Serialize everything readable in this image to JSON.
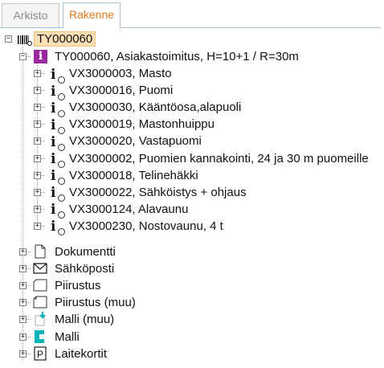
{
  "tabs": [
    {
      "label": "Arkisto",
      "active": false
    },
    {
      "label": "Rakenne",
      "active": true
    }
  ],
  "tree": {
    "root": {
      "label": "TY000060",
      "icon": "barcode-icon"
    },
    "object": {
      "label": "TY000060, Asiakastoimitus, H=10+1 / R=30m",
      "icon": "purple-info-icon"
    },
    "components": [
      {
        "label": "VX3000003, Masto"
      },
      {
        "label": "VX3000016, Puomi"
      },
      {
        "label": "VX3000030, Kääntöosa,alapuoli"
      },
      {
        "label": "VX3000019, Mastonhuippu"
      },
      {
        "label": "VX3000020, Vastapuomi"
      },
      {
        "label": "VX3000002, Puomien kannakointi, 24 ja 30 m puomeille"
      },
      {
        "label": "VX3000018, Telinehäkki"
      },
      {
        "label": "VX3000022, Sähköistys + ohjaus"
      },
      {
        "label": "VX3000124, Alavaunu"
      },
      {
        "label": "VX3000230, Nostovaunu, 4 t"
      }
    ],
    "folders": [
      {
        "label": "Dokumentti",
        "icon": "document-icon"
      },
      {
        "label": "Sähköposti",
        "icon": "envelope-icon"
      },
      {
        "label": "Piirustus",
        "icon": "drawing-icon"
      },
      {
        "label": "Piirustus (muu)",
        "icon": "drawing-other-icon"
      },
      {
        "label": "Malli (muu)",
        "icon": "model-other-icon"
      },
      {
        "label": "Malli",
        "icon": "model-icon"
      },
      {
        "label": "Laitekortit",
        "icon": "device-card-icon"
      }
    ],
    "colors": {
      "accent": "#e07a1e",
      "purple": "#9b2aa1",
      "selected_bg": "#fbe0b6",
      "model_teal": "#00b5b8"
    }
  }
}
